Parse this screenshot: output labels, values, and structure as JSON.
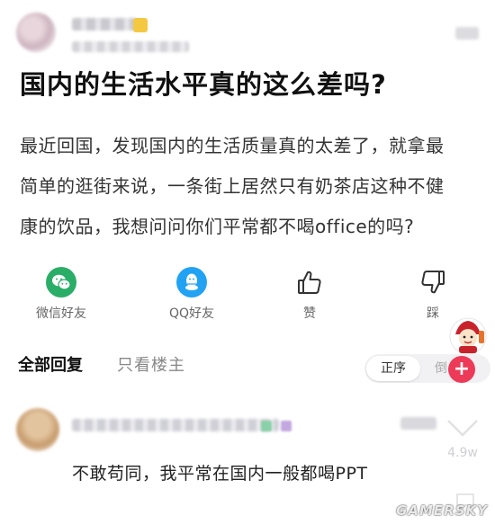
{
  "post": {
    "title": "国内的生活水平真的这么差吗?",
    "body_lines": [
      "最近回国，发现国内的生活质量真的太差了，就拿最",
      "简单的逛街来说，一条街上居然只有奶茶店这种不健",
      "康的饮品，我想问问你们平常都不喝office的吗?"
    ]
  },
  "share": {
    "wechat_label": "微信好友",
    "qq_label": "QQ好友",
    "like_label": "赞",
    "dislike_label": "踩"
  },
  "comments": {
    "tab_all": "全部回复",
    "tab_op_only": "只看楼主",
    "sort_active": "正序",
    "sort_other": "倒",
    "add_symbol": "+",
    "first_comment": {
      "text": "不敢苟同，我平常在国内一般都喝PPT",
      "likes": "4.9w"
    }
  },
  "watermark": "GAMERSKY",
  "colors": {
    "wechat_green": "#2aae67",
    "qq_blue": "#22a2f2",
    "add_button_red": "#ec3a58"
  }
}
